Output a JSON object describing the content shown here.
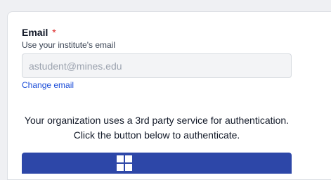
{
  "form": {
    "email_label": "Email",
    "required_marker": "*",
    "email_hint": "Use your institute's email",
    "email_value": "astudent@mines.edu",
    "change_email_link": "Change email",
    "auth_message": "Your organization uses a 3rd party service for authentication. Click the button below to authenticate.",
    "auth_button_icon": "sso-provider-icon"
  },
  "colors": {
    "accent": "#2d47a8",
    "link": "#1d4ed8",
    "required": "#dc2626"
  }
}
